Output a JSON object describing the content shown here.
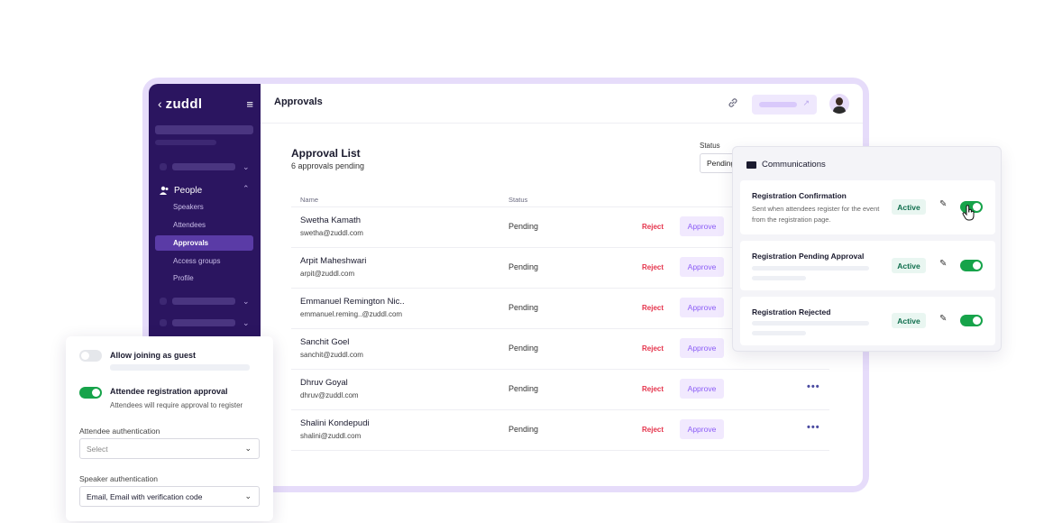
{
  "sidebar": {
    "brand": "zuddl",
    "back_icon": "chevron-left-icon",
    "menu_icon": "hamburger-icon",
    "people_label": "People",
    "items": [
      {
        "label": "Speakers",
        "active": false
      },
      {
        "label": "Attendees",
        "active": false
      },
      {
        "label": "Approvals",
        "active": true
      },
      {
        "label": "Access groups",
        "active": false
      },
      {
        "label": "Profile",
        "active": false
      }
    ]
  },
  "header": {
    "title": "Approvals",
    "link_icon": "link-icon",
    "avatar_icon": "user-avatar"
  },
  "approvals": {
    "title": "Approval List",
    "subtitle": "6 approvals pending",
    "status_filter_label": "Status",
    "status_filter_value": "Pending",
    "columns": {
      "name": "Name",
      "status": "Status"
    },
    "rows": [
      {
        "name": "Swetha Kamath",
        "email": "swetha@zuddl.com",
        "status": "Pending",
        "reject": "Reject",
        "approve": "Approve",
        "more": false
      },
      {
        "name": "Arpit Maheshwari",
        "email": "arpit@zuddl.com",
        "status": "Pending",
        "reject": "Reject",
        "approve": "Approve",
        "more": false
      },
      {
        "name": "Emmanuel Remington Nic..",
        "email": "emmanuel.reming..@zuddl.com",
        "status": "Pending",
        "reject": "Reject",
        "approve": "Approve",
        "more": false
      },
      {
        "name": "Sanchit Goel",
        "email": "sanchit@zuddl.com",
        "status": "Pending",
        "reject": "Reject",
        "approve": "Approve",
        "more": false
      },
      {
        "name": "Dhruv Goyal",
        "email": "dhruv@zuddl.com",
        "status": "Pending",
        "reject": "Reject",
        "approve": "Approve",
        "more": true
      },
      {
        "name": "Shalini Kondepudi",
        "email": "shalini@zuddl.com",
        "status": "Pending",
        "reject": "Reject",
        "approve": "Approve",
        "more": true
      }
    ],
    "more_glyph": "•••"
  },
  "communications": {
    "title": "Communications",
    "cards": [
      {
        "title": "Registration Confirmation",
        "description": "Sent when attendees register for the event from the registration page.",
        "badge": "Active",
        "enabled": true
      },
      {
        "title": "Registration Pending Approval",
        "description": "",
        "badge": "Active",
        "enabled": true
      },
      {
        "title": "Registration Rejected",
        "description": "",
        "badge": "Active",
        "enabled": true
      }
    ]
  },
  "settings": {
    "guest_label": "Allow joining as guest",
    "guest_enabled": false,
    "approval_label": "Attendee registration approval",
    "approval_desc": "Attendees will require approval to register",
    "approval_enabled": true,
    "attendee_auth_label": "Attendee authentication",
    "attendee_auth_placeholder": "Select",
    "speaker_auth_label": "Speaker authentication",
    "speaker_auth_value": "Email, Email with verification code"
  },
  "colors": {
    "sidebar_bg": "#2b1560",
    "accent": "#8b5cf6",
    "reject": "#e5334b",
    "toggle_on": "#16a34a"
  }
}
